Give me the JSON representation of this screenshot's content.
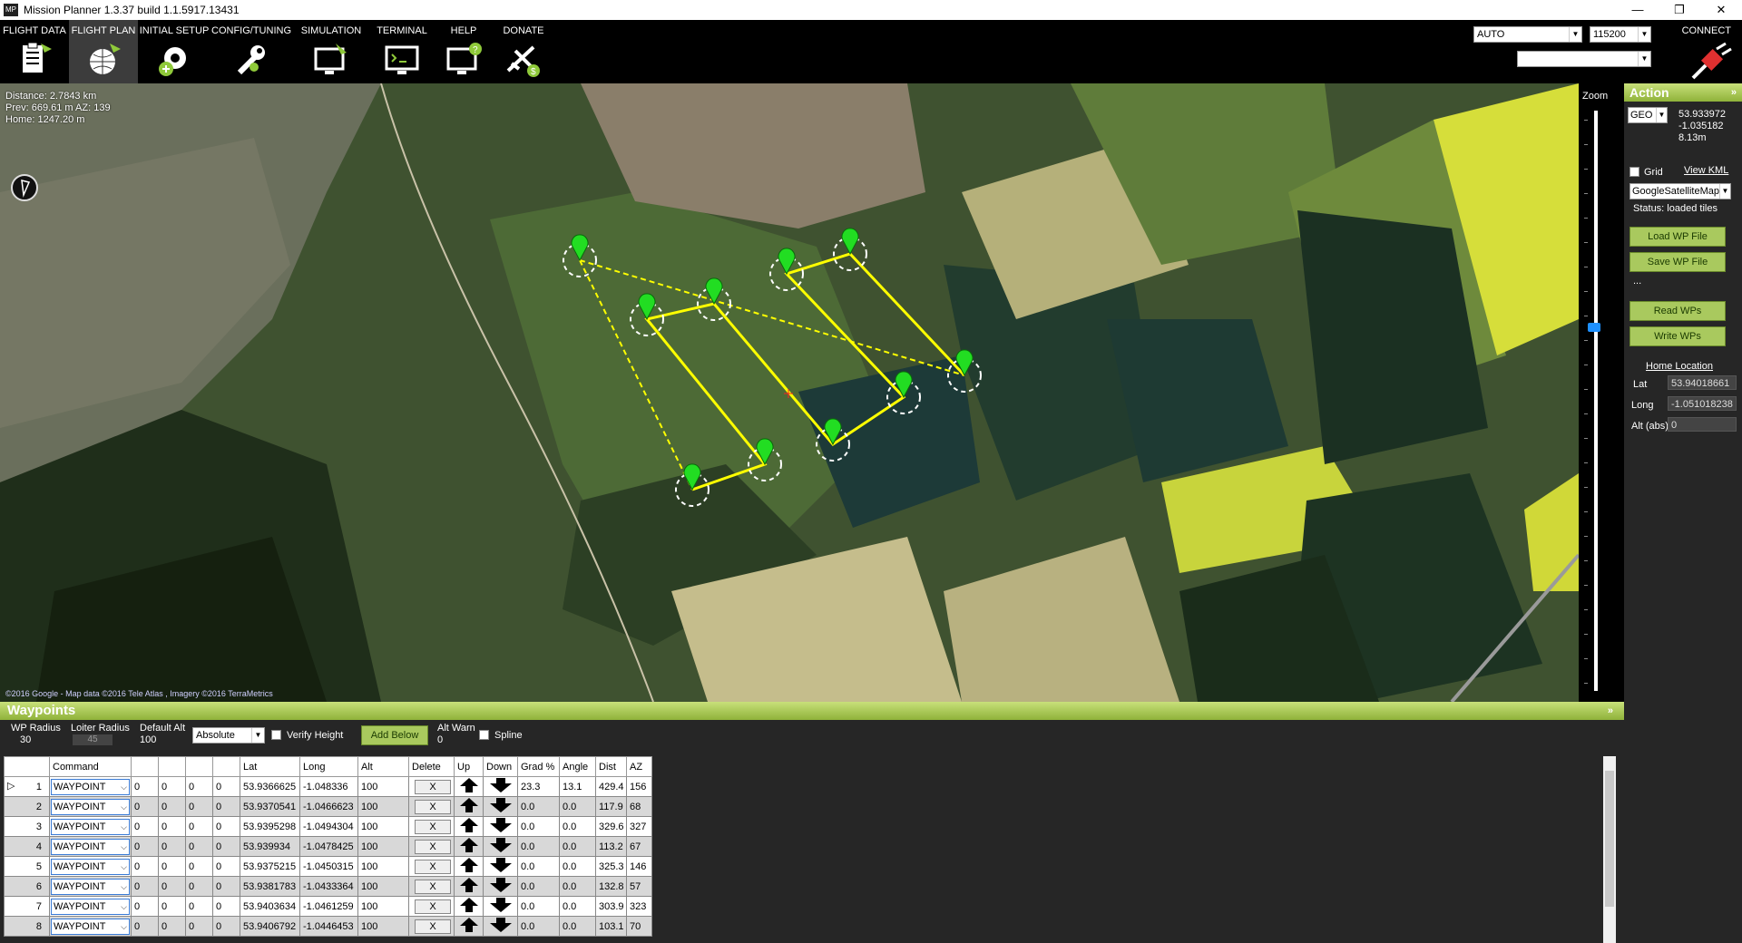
{
  "app": {
    "title": "Mission Planner 1.3.37 build 1.1.5917.13431",
    "logo": "MP"
  },
  "window_controls": {
    "minimize": "—",
    "restore": "❐",
    "close": "✕"
  },
  "menu": [
    {
      "label": "FLIGHT DATA",
      "icon": "clipboard-icon"
    },
    {
      "label": "FLIGHT PLAN",
      "icon": "globe-pin-icon",
      "active": true
    },
    {
      "label": "INITIAL SETUP",
      "icon": "gear-setup-icon"
    },
    {
      "label": "CONFIG/TUNING",
      "icon": "wrench-icon"
    },
    {
      "label": "SIMULATION",
      "icon": "monitor-plane-icon"
    },
    {
      "label": "TERMINAL",
      "icon": "terminal-icon"
    },
    {
      "label": "HELP",
      "icon": "help-monitor-icon"
    },
    {
      "label": "DONATE",
      "icon": "plane-dollar-icon"
    }
  ],
  "connection": {
    "port": "AUTO",
    "baud": "115200",
    "profile": "",
    "connect_label": "CONNECT"
  },
  "map": {
    "distance": "Distance: 2.7843 km",
    "prev": "Prev: 669.61 m AZ: 139",
    "home": "Home: 1247.20 m",
    "credit": "©2016 Google - Map data ©2016 Tele Atlas , Imagery ©2016 TerraMetrics",
    "zoom_label": "Zoom",
    "zoom_level": 0.62
  },
  "action_panel": {
    "title": "Action",
    "coord_mode": "GEO",
    "lat": "53.933972",
    "lng": "-1.035182",
    "alt": "8.13m",
    "grid_label": "Grid",
    "view_kml": "View KML",
    "map_type": "GoogleSatelliteMap",
    "status": "Status: loaded tiles",
    "load_wp": "Load WP File",
    "save_wp": "Save WP File",
    "ellipsis": "...",
    "read_wps": "Read WPs",
    "write_wps": "Write WPs",
    "home_location": "Home Location",
    "home_lat_label": "Lat",
    "home_lat": "53.94018661",
    "home_long_label": "Long",
    "home_long": "-1.051018238",
    "home_alt_label": "Alt (abs)",
    "home_alt": "0"
  },
  "waypoints_panel": {
    "title": "Waypoints",
    "wp_radius_label": "WP Radius",
    "wp_radius": "30",
    "loiter_radius_label": "Loiter Radius",
    "loiter_radius": "45",
    "default_alt_label": "Default Alt",
    "default_alt": "100",
    "alt_mode": "Absolute",
    "verify_height": "Verify Height",
    "add_below": "Add Below",
    "alt_warn_label": "Alt Warn",
    "alt_warn": "0",
    "spline": "Spline"
  },
  "table": {
    "headers": [
      "",
      "Command",
      "",
      "",
      "",
      "",
      "Lat",
      "Long",
      "Alt",
      "Delete",
      "Up",
      "Down",
      "Grad %",
      "Angle",
      "Dist",
      "AZ"
    ],
    "delete_label": "X",
    "rows": [
      {
        "n": "1",
        "cmd": "WAYPOINT",
        "p1": "0",
        "p2": "0",
        "p3": "0",
        "p4": "0",
        "lat": "53.9366625",
        "lng": "-1.048336",
        "alt": "100",
        "grad": "23.3",
        "angle": "13.1",
        "dist": "429.4",
        "az": "156"
      },
      {
        "n": "2",
        "cmd": "WAYPOINT",
        "p1": "0",
        "p2": "0",
        "p3": "0",
        "p4": "0",
        "lat": "53.9370541",
        "lng": "-1.0466623",
        "alt": "100",
        "grad": "0.0",
        "angle": "0.0",
        "dist": "117.9",
        "az": "68"
      },
      {
        "n": "3",
        "cmd": "WAYPOINT",
        "p1": "0",
        "p2": "0",
        "p3": "0",
        "p4": "0",
        "lat": "53.9395298",
        "lng": "-1.0494304",
        "alt": "100",
        "grad": "0.0",
        "angle": "0.0",
        "dist": "329.6",
        "az": "327"
      },
      {
        "n": "4",
        "cmd": "WAYPOINT",
        "p1": "0",
        "p2": "0",
        "p3": "0",
        "p4": "0",
        "lat": "53.939934",
        "lng": "-1.0478425",
        "alt": "100",
        "grad": "0.0",
        "angle": "0.0",
        "dist": "113.2",
        "az": "67"
      },
      {
        "n": "5",
        "cmd": "WAYPOINT",
        "p1": "0",
        "p2": "0",
        "p3": "0",
        "p4": "0",
        "lat": "53.9375215",
        "lng": "-1.0450315",
        "alt": "100",
        "grad": "0.0",
        "angle": "0.0",
        "dist": "325.3",
        "az": "146"
      },
      {
        "n": "6",
        "cmd": "WAYPOINT",
        "p1": "0",
        "p2": "0",
        "p3": "0",
        "p4": "0",
        "lat": "53.9381783",
        "lng": "-1.0433364",
        "alt": "100",
        "grad": "0.0",
        "angle": "0.0",
        "dist": "132.8",
        "az": "57"
      },
      {
        "n": "7",
        "cmd": "WAYPOINT",
        "p1": "0",
        "p2": "0",
        "p3": "0",
        "p4": "0",
        "lat": "53.9403634",
        "lng": "-1.0461259",
        "alt": "100",
        "grad": "0.0",
        "angle": "0.0",
        "dist": "303.9",
        "az": "323"
      },
      {
        "n": "8",
        "cmd": "WAYPOINT",
        "p1": "0",
        "p2": "0",
        "p3": "0",
        "p4": "0",
        "lat": "53.9406792",
        "lng": "-1.0446453",
        "alt": "100",
        "grad": "0.0",
        "angle": "0.0",
        "dist": "103.1",
        "az": "70"
      }
    ]
  },
  "colors": {
    "accent_green": "#a9c95e",
    "route": "#ffff00",
    "marker": "#22dd22",
    "zoom_thumb": "#1e90ff"
  }
}
